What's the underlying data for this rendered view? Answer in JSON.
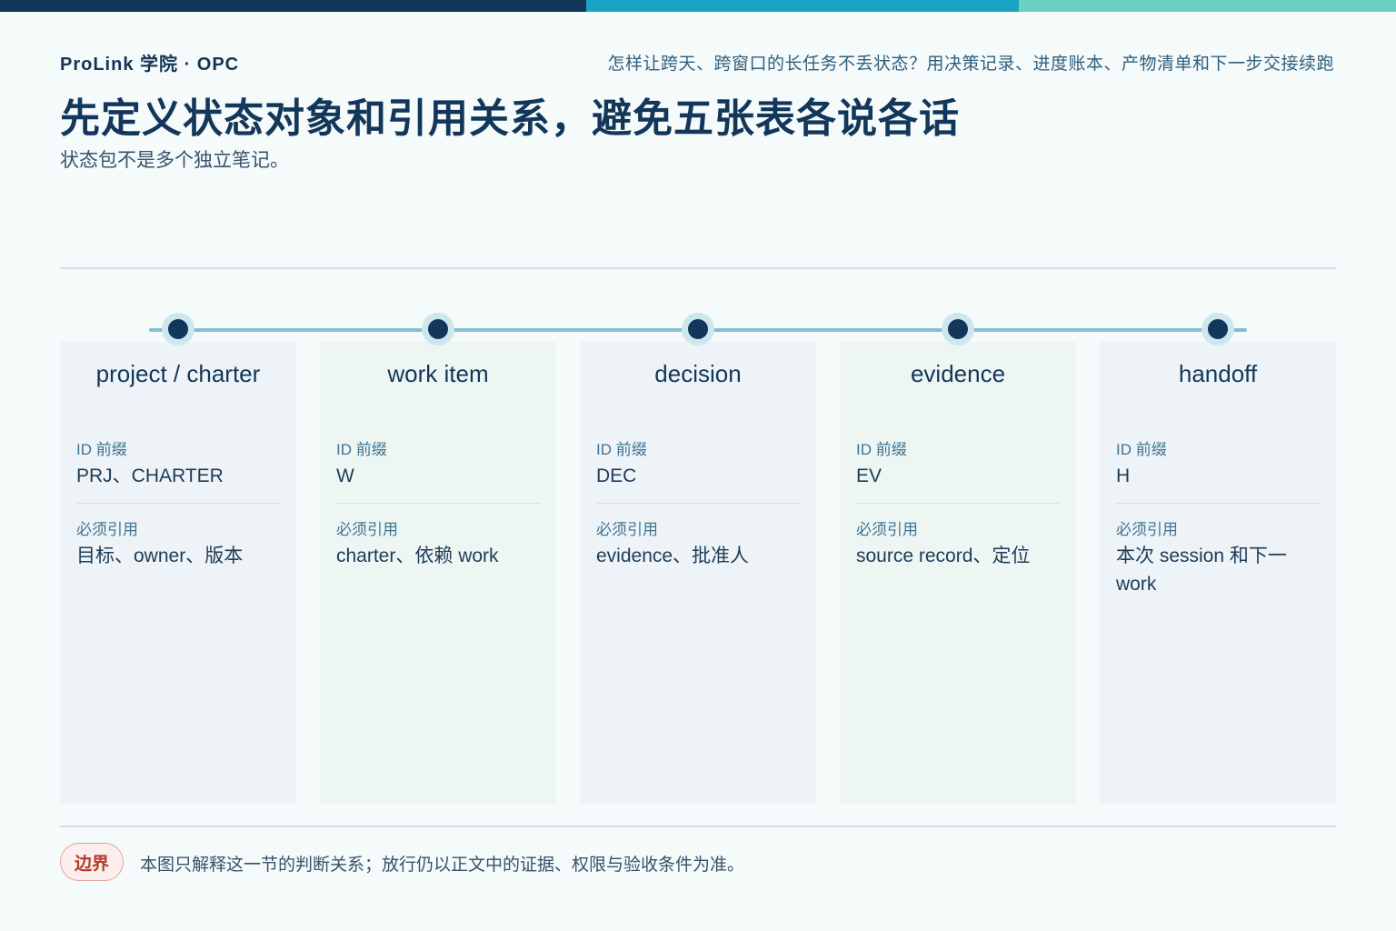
{
  "colors": {
    "navy": "#12375a",
    "teal": "#1aa3c0",
    "mint": "#6bd0c0",
    "badge_red": "#b53a2c"
  },
  "header": {
    "brand": "ProLink 学院 · OPC",
    "question": "怎样让跨天、跨窗口的长任务不丢状态？用决策记录、进度账本、产物清单和下一步交接续跑",
    "title": "先定义状态对象和引用关系，避免五张表各说各话",
    "subtitle": "状态包不是多个独立笔记。"
  },
  "cards": [
    {
      "title": "project / charter",
      "id_label": "ID 前缀",
      "id_value": "PRJ、CHARTER",
      "ref_label": "必须引用",
      "ref_value": "目标、owner、版本"
    },
    {
      "title": "work item",
      "id_label": "ID 前缀",
      "id_value": "W",
      "ref_label": "必须引用",
      "ref_value": "charter、依赖 work"
    },
    {
      "title": "decision",
      "id_label": "ID 前缀",
      "id_value": "DEC",
      "ref_label": "必须引用",
      "ref_value": "evidence、批准人"
    },
    {
      "title": "evidence",
      "id_label": "ID 前缀",
      "id_value": "EV",
      "ref_label": "必须引用",
      "ref_value": "source record、定位"
    },
    {
      "title": "handoff",
      "id_label": "ID 前缀",
      "id_value": "H",
      "ref_label": "必须引用",
      "ref_value": "本次 session 和下一 work"
    }
  ],
  "footer": {
    "badge": "边界",
    "note": "本图只解释这一节的判断关系；放行仍以正文中的证据、权限与验收条件为准。"
  }
}
